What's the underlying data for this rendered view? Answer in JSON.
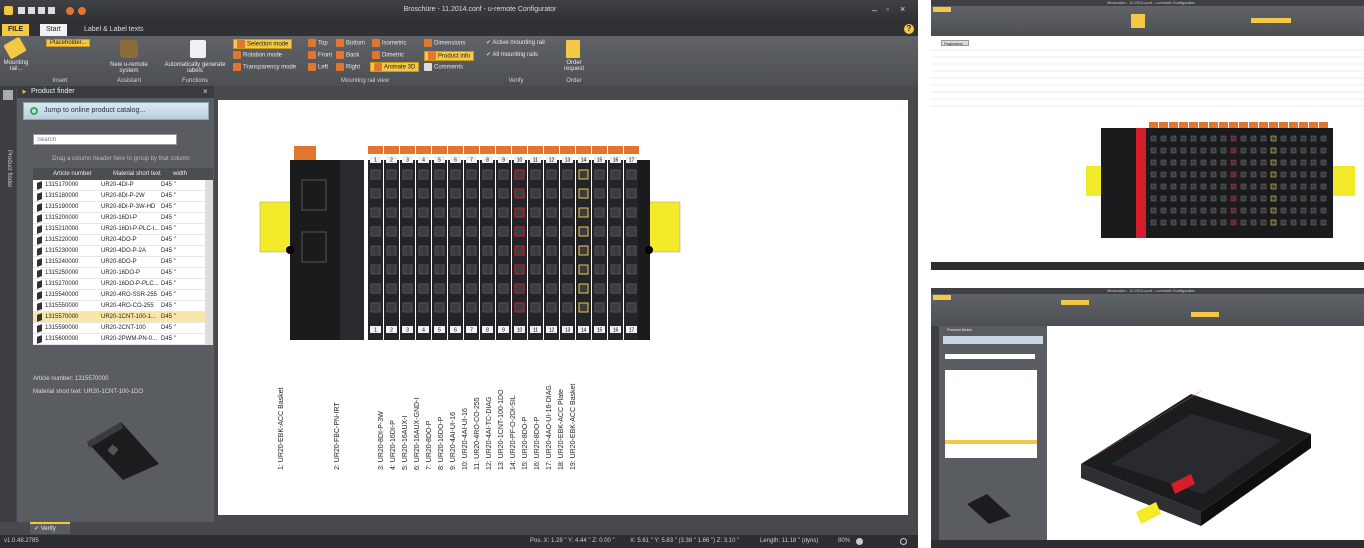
{
  "window": {
    "title": "Broschüre - 11.2014.conf - u-remote Configurator"
  },
  "tabs": [
    {
      "label": "FILE"
    },
    {
      "label": "Start"
    },
    {
      "label": "Label & Label texts"
    }
  ],
  "ribbon": {
    "mounting": {
      "label": "Mounting rail..."
    },
    "placeholder": {
      "label": "Placeholder..."
    },
    "new_system": {
      "label": "New u-remote system"
    },
    "auto_labels": {
      "label": "Automatically generate labels"
    },
    "selection_mode": {
      "label": "Selection mode"
    },
    "rotation_mode": {
      "label": "Rotation mode"
    },
    "transparency_mode": {
      "label": "Transparency mode"
    },
    "views": [
      {
        "label": "Top"
      },
      {
        "label": "Bottom"
      },
      {
        "label": "Isometric"
      },
      {
        "label": "Front"
      },
      {
        "label": "Back"
      },
      {
        "label": "Dimetric"
      },
      {
        "label": "Left"
      },
      {
        "label": "Right"
      },
      {
        "label": "Animate 3D"
      }
    ],
    "dimensions": {
      "label": "Dimensions"
    },
    "product_info": {
      "label": "Product info"
    },
    "comments": {
      "label": "Comments"
    },
    "active_rail": {
      "label": "Active mounting rail"
    },
    "all_rails": {
      "label": "All mounting rails"
    },
    "order": {
      "label": "Order request"
    },
    "order2": {
      "label": "Order"
    },
    "groups": {
      "insert": "Insert",
      "assistant": "Assistant",
      "functions": "Functions",
      "rail_view": "Mounting rail view",
      "verify": "Verify"
    }
  },
  "side_tab": {
    "label": "Product finder"
  },
  "finder": {
    "title": "Product finder",
    "jump_button": "Jump to online product catalog...",
    "search_placeholder": "Search",
    "group_hint": "Drag a column header here to group by that column",
    "columns": [
      "Article number",
      "Material short text",
      "width"
    ],
    "rows": [
      [
        "1315170000",
        "UR20-4DI-P",
        "D45 \""
      ],
      [
        "1315180000",
        "UR20-8DI-P-2W",
        "D45 \""
      ],
      [
        "1315190000",
        "UR20-8DI-P-3W-HD",
        "D45 \""
      ],
      [
        "1315200000",
        "UR20-16DI-P",
        "D45 \""
      ],
      [
        "1315210000",
        "UR20-16DI-P-PLC-I...",
        "D45 \""
      ],
      [
        "1315220000",
        "UR20-4DO-P",
        "D45 \""
      ],
      [
        "1315230000",
        "UR20-4DO-P-2A",
        "D45 \""
      ],
      [
        "1315240000",
        "UR20-8DO-P",
        "D45 \""
      ],
      [
        "1315250000",
        "UR20-16DO-P",
        "D45 \""
      ],
      [
        "1315270000",
        "UR20-16DO-P-PLC...",
        "D45 \""
      ],
      [
        "1315540000",
        "UR20-4RO-SSR-255",
        "D45 \""
      ],
      [
        "1315550000",
        "UR20-4RO-CO-255",
        "D45 \""
      ],
      [
        "1315570000",
        "UR20-1CNT-100-1...",
        "D45 \""
      ],
      [
        "1315590000",
        "UR20-2CNT-100",
        "D45 \""
      ],
      [
        "1315600000",
        "UR20-2PWM-PN-0...",
        "D45 \""
      ]
    ],
    "selected_index": 12,
    "detail_article_label": "Article number:",
    "detail_article": "1315570000",
    "detail_material_label": "Material short text:",
    "detail_material": "UR20-1CNT-100-1DO"
  },
  "verify_tab": {
    "label": "Verify"
  },
  "module_labels": [
    "1: UR20-EBK-ACC Basket",
    "2: UR20-FBC-PN-IRT",
    "3: UR20-8DI-P-3W",
    "4: UR20-16DI-P",
    "5: UR20-16AUX-I",
    "6: UR20-16AUX-GND-I",
    "7: UR20-8DO-P",
    "8: UR20-16DO-P",
    "9: UR20-4AI-UI-16",
    "10: UR20-4AI-UI-16",
    "11: UR20-4RO-CO-255",
    "12: UR20-4AI-TC-DIAG",
    "13: UR20-1CNT-100-1DO",
    "14: UR20-PF-O-2DI-SIL",
    "15: UR20-8DO-P",
    "16: UR20-8DO-P",
    "17: UR20-4AO-UI-16-DIAG",
    "18: UR20-EBK-ACC Plate",
    "19: UR20-EBK-ACC Basket"
  ],
  "slot_numbers": [
    "1",
    "2",
    "3",
    "4",
    "5",
    "6",
    "7",
    "8",
    "9",
    "10",
    "11",
    "12",
    "13",
    "14",
    "15",
    "16",
    "17"
  ],
  "status": {
    "version": "v1.0.48.2785",
    "pos": "Pos. X: 1.28 \" Y: 4.44 \" Z: 0.00 \"",
    "pos2": "X: 5.61 \" Y: 5.83 \" (3.38 \" 1.66 \") Z: 3.10 \"",
    "length": "Length: 11.18 \" (dyns)",
    "zoom": "80%"
  },
  "right1": {
    "title": "Broschüre - 11.2014.conf - u-remote Configurator",
    "tab": "Pagination"
  },
  "right2": {
    "title": "Broschüre - 11.2014.conf - u-remote Configurator",
    "finder_title": "Product finder"
  },
  "colors": {
    "accent": "#f4c845",
    "rail": "#f3ea2a",
    "terminal": "#e2762f",
    "red": "#d61d2c"
  }
}
